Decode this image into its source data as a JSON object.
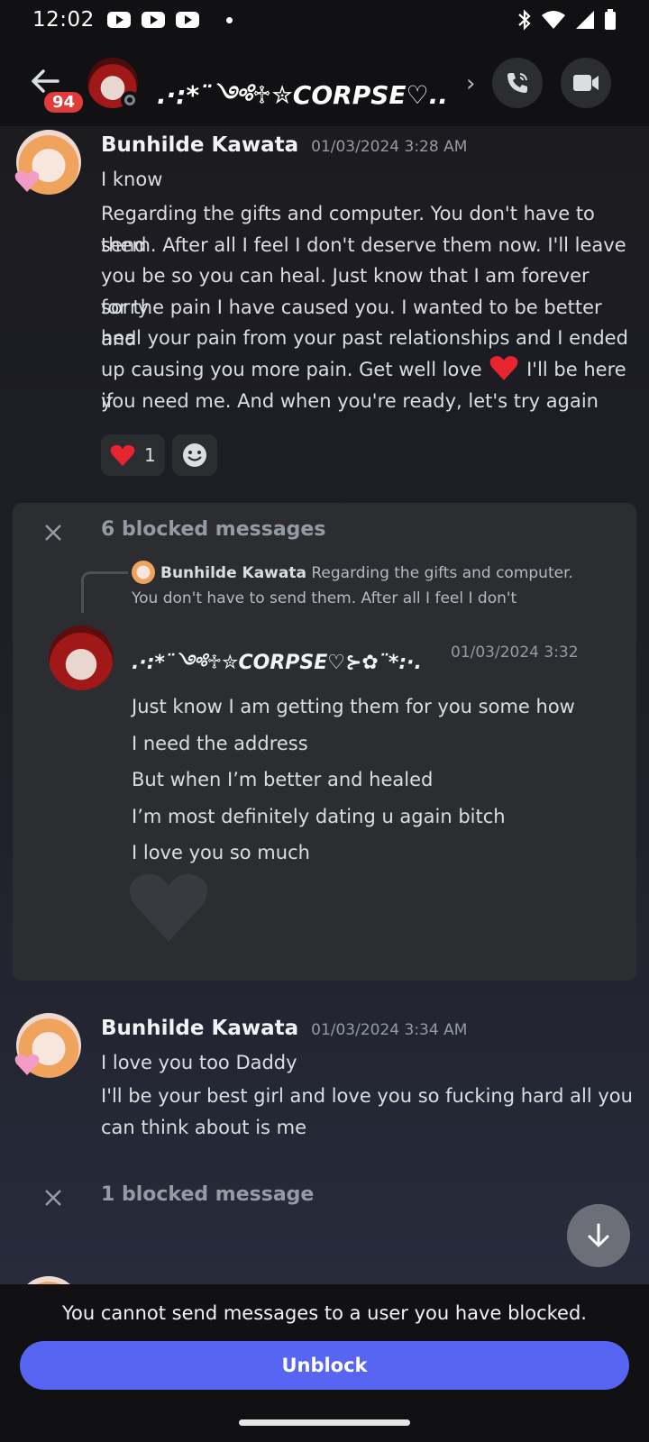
{
  "status_bar": {
    "time": "12:02"
  },
  "header": {
    "unread_badge": "94",
    "title": ".·:*¨༺♱✮CORPSE♡...",
    "chevron": "›"
  },
  "messages": [
    {
      "author": "Bunhilde Kawata",
      "timestamp": "01/03/2024 3:28 AM",
      "lines": [
        "I know",
        "Regarding the gifts and computer. You don't have to send",
        "them. After all I feel I don't deserve them now. I'll leave",
        "you be so you can heal. Just know that I am forever sorry",
        "for the pain I have caused you. I wanted to be better and",
        "heal your pain from your past relationships and I ended",
        "up causing you more pain. Get well love",
        "I'll be here if",
        "you need me. And when you're ready, let's try again"
      ],
      "reaction_count": "1"
    },
    {
      "author": "Bunhilde Kawata",
      "timestamp": "01/03/2024 3:34 AM",
      "lines": [
        "I love you too Daddy",
        "I'll be your best girl and love you so fucking hard all you",
        "can think about is me"
      ]
    }
  ],
  "blocked_group": {
    "label": "6 blocked messages",
    "reply_author": "Bunhilde Kawata",
    "reply_preview_1": "Regarding the gifts and computer.",
    "reply_preview_2": "You don't have to send them. After all I feel I don't",
    "author": ".·:*¨༺♱✮CORPSE♡⊱✿¨*:·.",
    "timestamp": "01/03/2024 3:32",
    "lines": [
      "Just know I am getting them for you some how",
      "I need the address",
      "But when I’m better and healed",
      "I’m most definitely dating u again bitch",
      "I love you so much"
    ]
  },
  "blocked_single": {
    "label": "1 blocked message"
  },
  "footer": {
    "note": "You cannot send messages to a user you have blocked.",
    "unblock_label": "Unblock"
  },
  "colors": {
    "accent": "#5865f2",
    "badge": "#e03c3c",
    "heart": "#e8242f"
  }
}
